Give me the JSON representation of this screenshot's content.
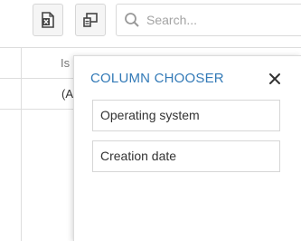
{
  "toolbar": {
    "export_icon": "excel-export-icon",
    "column_chooser_icon": "column-chooser-icon",
    "search": {
      "icon": "search-icon",
      "placeholder": "Search..."
    }
  },
  "grid": {
    "visible_header_text": "Is",
    "visible_row_text": "(A"
  },
  "column_chooser": {
    "title": "COLUMN CHOOSER",
    "close_icon": "close-icon",
    "items": [
      {
        "label": "Operating system"
      },
      {
        "label": "Creation date"
      }
    ]
  },
  "colors": {
    "accent": "#337ab7",
    "border": "#dddddd",
    "button_bg": "#f5f5f5"
  }
}
